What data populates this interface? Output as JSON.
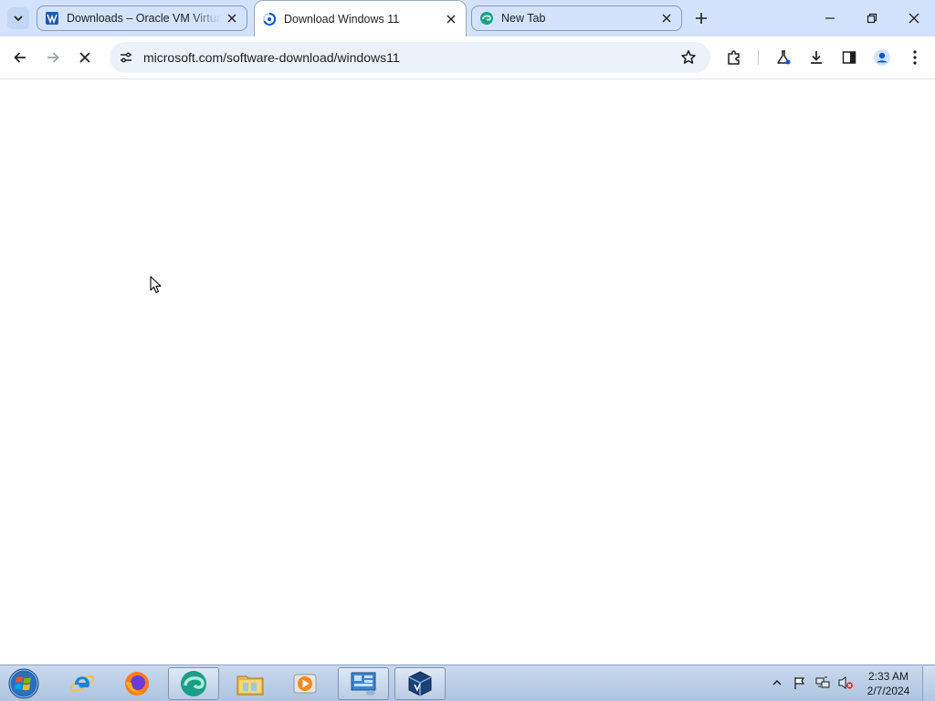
{
  "browser": {
    "tabs": [
      {
        "title": "Downloads – Oracle VM Virtua",
        "favicon": "virtualbox-logo-icon",
        "active": false
      },
      {
        "title": "Download Windows 11",
        "favicon": "loading-spinner-icon",
        "active": true
      },
      {
        "title": "New Tab",
        "favicon": "edge-logo-icon",
        "active": false
      }
    ],
    "address_bar": {
      "url": "microsoft.com/software-download/windows11"
    },
    "toolbar_icons": [
      "back-icon",
      "forward-icon",
      "stop-loading-icon",
      "site-info-icon",
      "bookmark-star-icon",
      "extensions-icon",
      "labs-flask-icon",
      "downloads-icon",
      "side-panel-icon",
      "profile-icon",
      "menu-icon"
    ],
    "colors": {
      "tabstrip": "#d3e3fd",
      "omnibox": "#edf2fa",
      "accent": "#0b57d0"
    }
  },
  "taskbar": {
    "pinned": [
      "start-orb-icon",
      "internet-explorer-icon",
      "firefox-icon",
      "edge-icon",
      "file-explorer-icon",
      "media-player-icon",
      "control-panel-icon",
      "virtualbox-icon"
    ],
    "tray_icons": [
      "show-hidden-icons-icon",
      "action-center-flag-icon",
      "network-icon",
      "volume-muted-icon"
    ],
    "clock": {
      "time": "2:33 AM",
      "date": "2/7/2024"
    }
  }
}
